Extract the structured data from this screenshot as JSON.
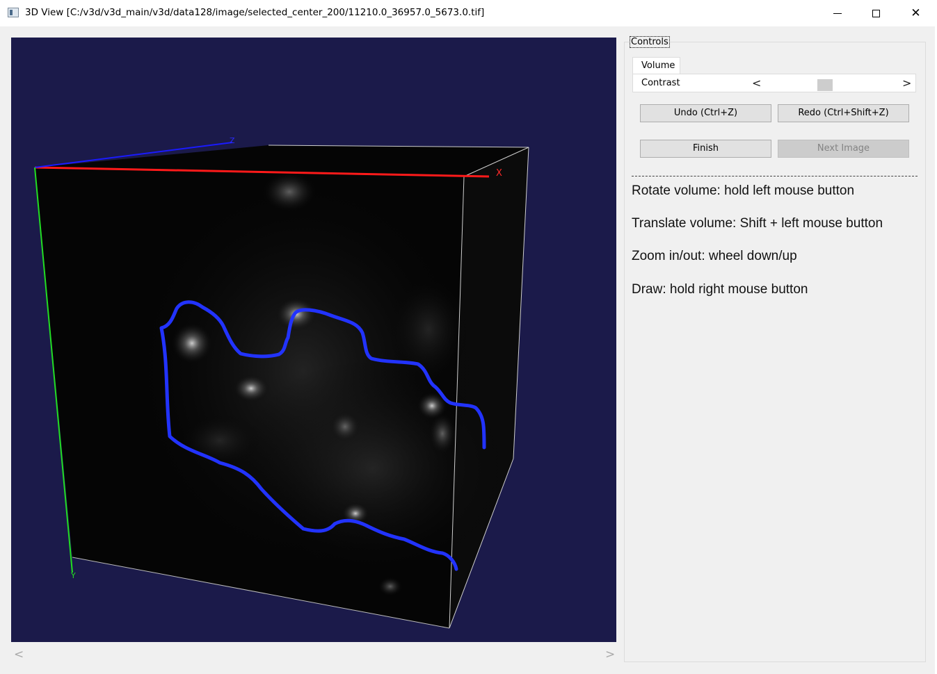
{
  "window": {
    "title": "3D View [C:/v3d/v3d_main/v3d/data128/image/selected_center_200/11210.0_36957.0_5673.0.tif]",
    "icon": "app-icon",
    "minimize_icon": "minimize-icon",
    "maximize_icon": "maximize-icon",
    "close_glyph": "✕"
  },
  "viewport": {
    "background_color": "#1b1a4a",
    "axis_labels": {
      "x": "X",
      "y": "Y",
      "z": "Z"
    },
    "axis_colors": {
      "x": "#ff1a1a",
      "y": "#22dd22",
      "z": "#1a1aff"
    },
    "trace_color": "#2233ff",
    "scroll_left": "<",
    "scroll_right": ">"
  },
  "controls": {
    "group_title": "Controls",
    "tabs": [
      {
        "label": "Volume"
      }
    ],
    "contrast_label": "Contrast",
    "slider_left": "<",
    "slider_right": ">",
    "contrast_value": 0.45,
    "buttons": {
      "undo": "Undo (Ctrl+Z)",
      "redo": "Redo (Ctrl+Shift+Z)",
      "finish": "Finish",
      "next_image": "Next Image"
    },
    "next_image_enabled": false,
    "help_lines": [
      "Rotate volume: hold left mouse button",
      "Translate volume: Shift + left mouse button",
      "Zoom in/out: wheel down/up",
      "Draw: hold right mouse button"
    ]
  }
}
